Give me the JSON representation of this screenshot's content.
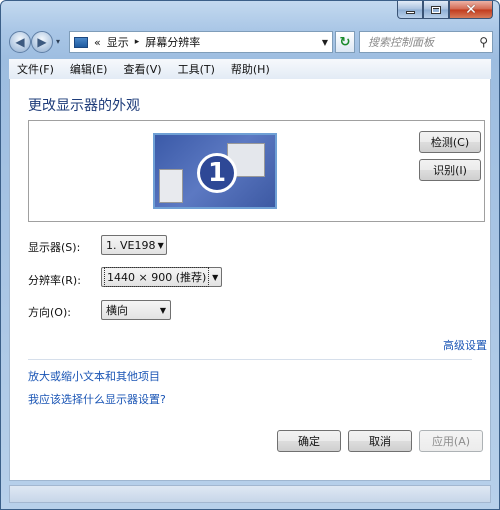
{
  "window": {
    "caption_buttons": {
      "close_glyph": "✕"
    }
  },
  "nav": {
    "back_glyph": "◀",
    "forward_glyph": "▶",
    "dropdown_glyph": "▾",
    "breadcrumb_prefix": "«",
    "breadcrumb": [
      "显示",
      "屏幕分辨率"
    ],
    "breadcrumb_sep": "▸",
    "address_dropdown_glyph": "▼",
    "refresh_glyph": "↻",
    "search_placeholder": "搜索控制面板",
    "search_glyph": "⚲"
  },
  "menu": {
    "items": [
      "文件(F)",
      "编辑(E)",
      "查看(V)",
      "工具(T)",
      "帮助(H)"
    ]
  },
  "main": {
    "title": "更改显示器的外观",
    "monitor_number": "1",
    "detect_label": "检测(C)",
    "identify_label": "识别(I)",
    "display_label": "显示器(S):",
    "display_value": "1. VE198",
    "resolution_label": "分辨率(R):",
    "resolution_value": "1440 × 900 (推荐)",
    "orientation_label": "方向(O):",
    "orientation_value": "横向",
    "advanced_link": "高级设置",
    "link_text_size": "放大或缩小文本和其他项目",
    "link_which_settings": "我应该选择什么显示器设置?",
    "ok_label": "确定",
    "cancel_label": "取消",
    "apply_label": "应用(A)"
  },
  "colors": {
    "title_text": "#1e3c7a",
    "link": "#1a55b5",
    "monitor_bg": "#3b5aa8"
  }
}
